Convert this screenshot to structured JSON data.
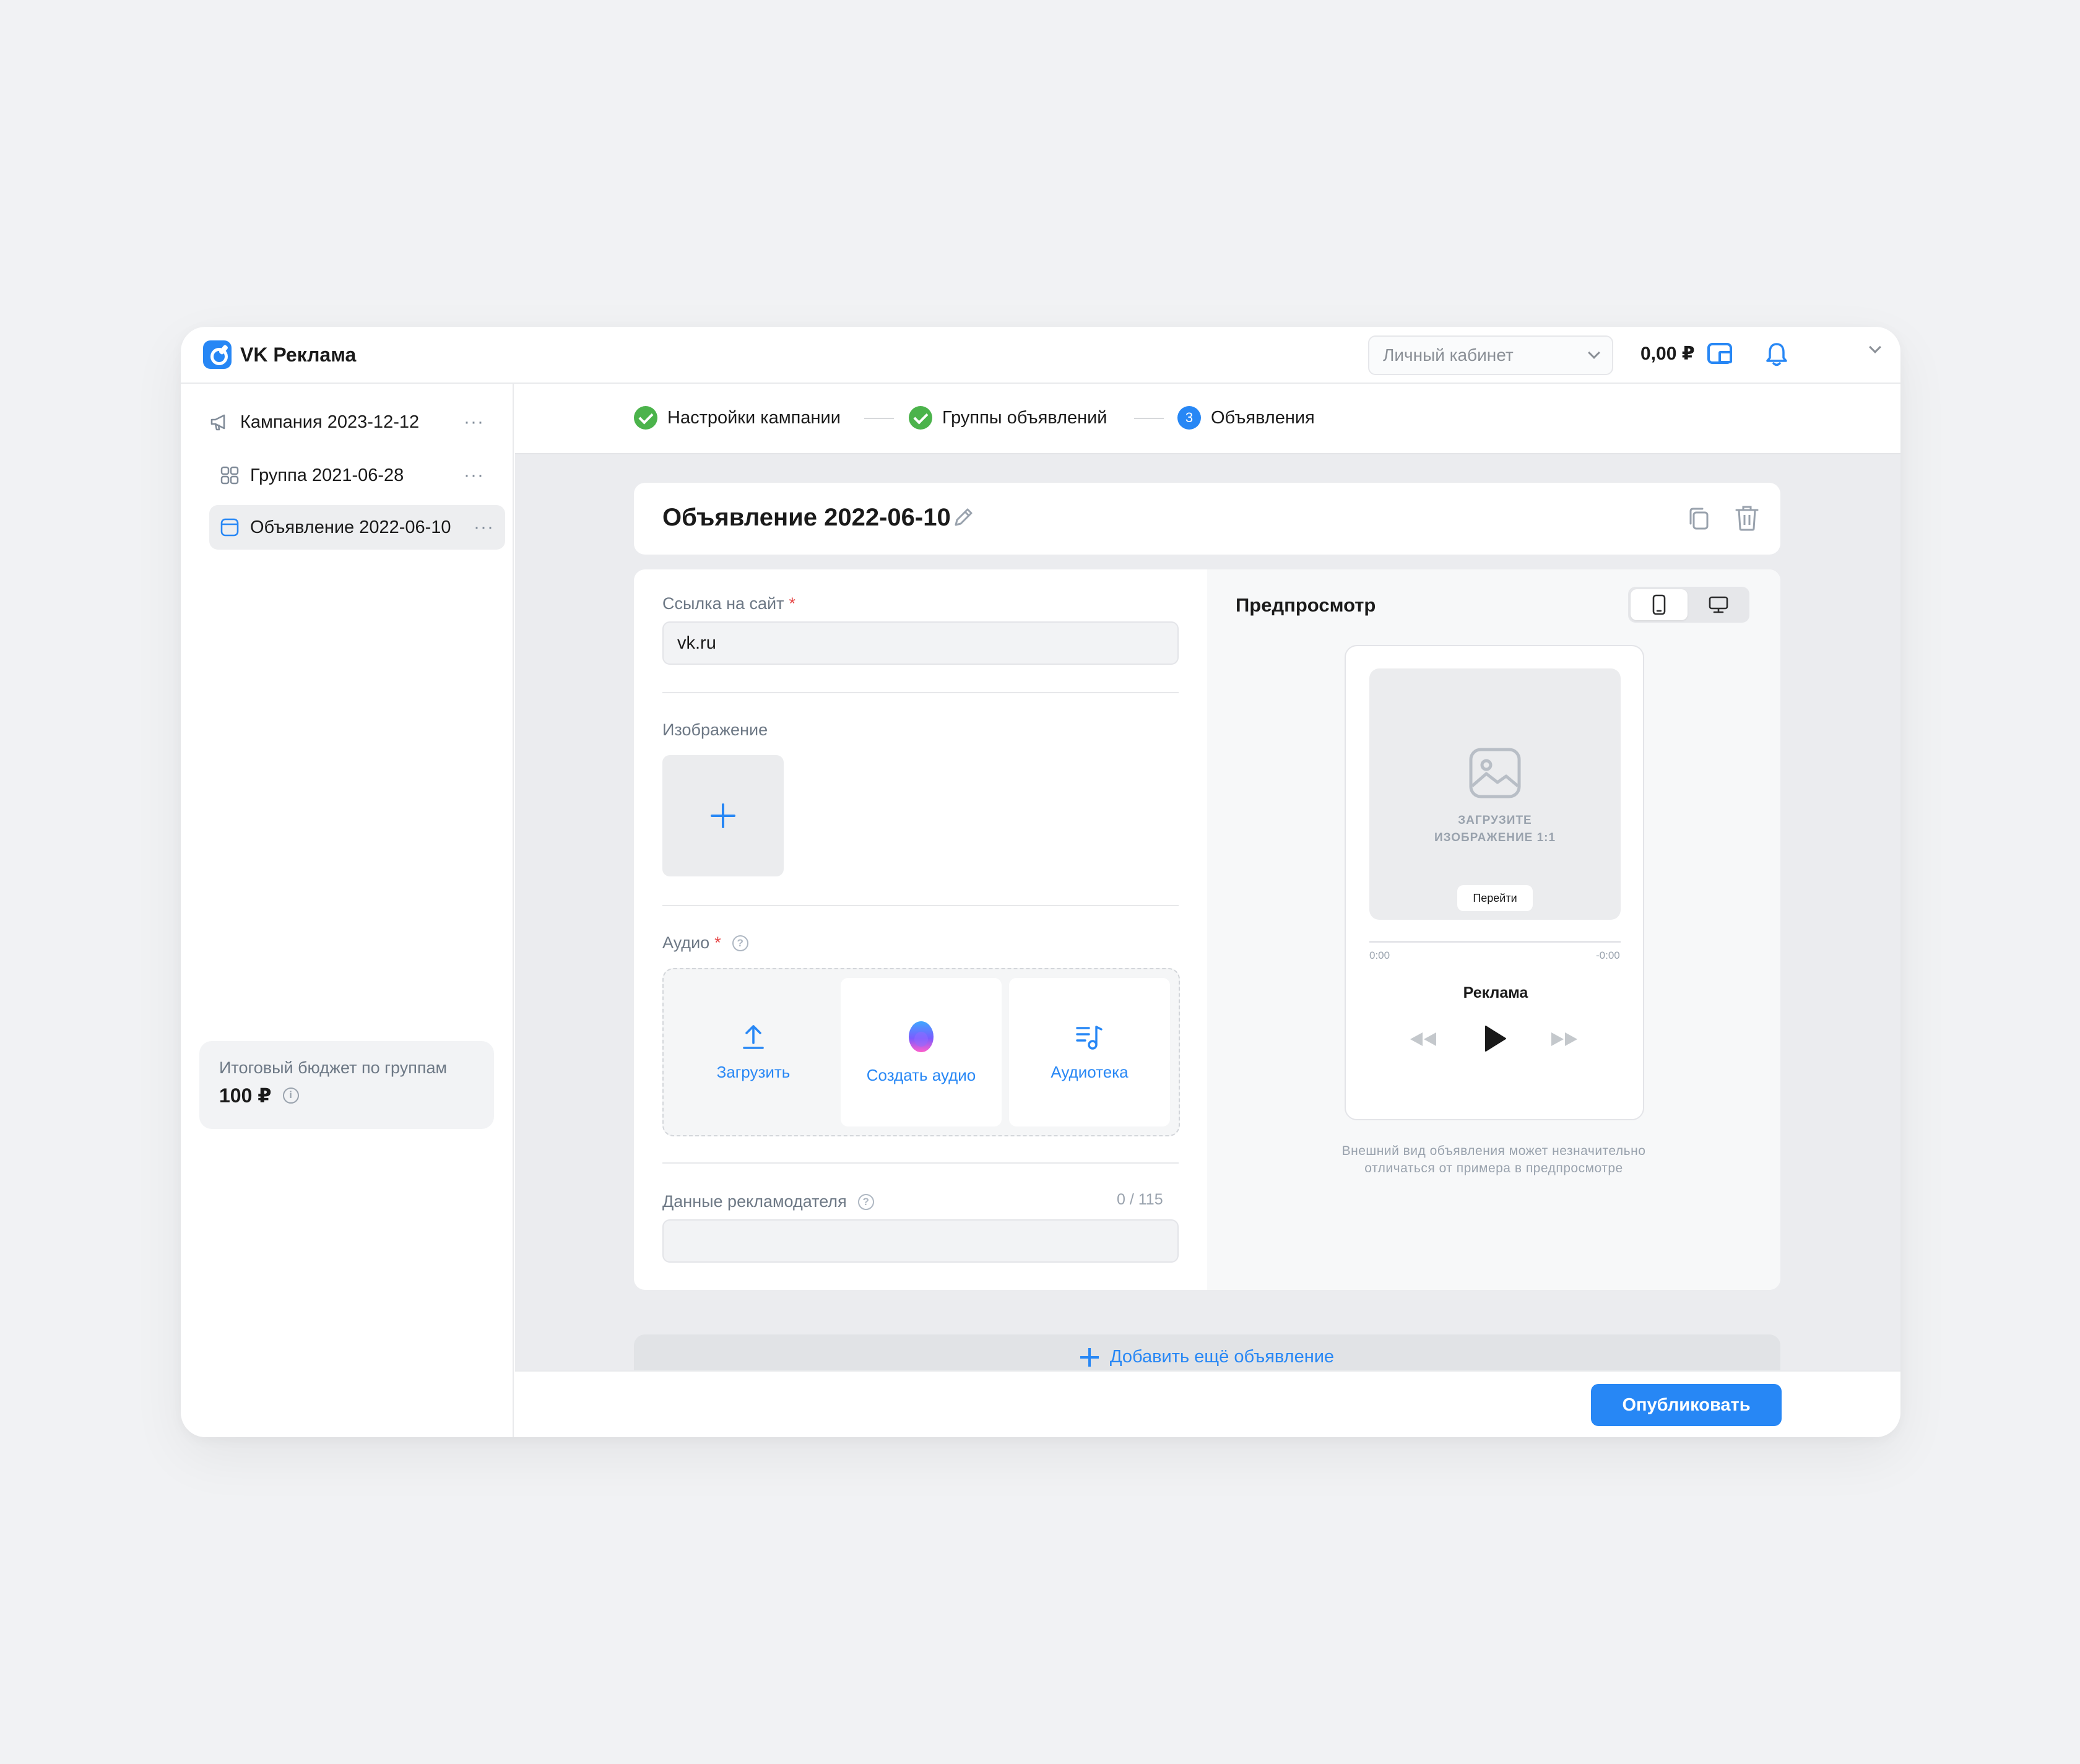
{
  "app": {
    "title": "VK Реклама",
    "brand_color": "#2787f5"
  },
  "header": {
    "account_select": "Личный кабинет",
    "balance": "0,00 ₽"
  },
  "sidebar": {
    "items": [
      {
        "label": "Кампания 2023-12-12",
        "icon": "megaphone-icon"
      },
      {
        "label": "Группа 2021-06-28",
        "icon": "grid-icon"
      },
      {
        "label": "Объявление 2022-06-10",
        "icon": "ad-card-icon",
        "active": true
      }
    ],
    "budget": {
      "title": "Итоговый бюджет по группам",
      "value": "100 ₽"
    }
  },
  "steps": [
    {
      "label": "Настройки кампании",
      "state": "done"
    },
    {
      "label": "Группы объявлений",
      "state": "done"
    },
    {
      "label": "Объявления",
      "state": "current",
      "number": "3"
    }
  ],
  "ad": {
    "title": "Объявление 2022-06-10"
  },
  "form": {
    "site_link": {
      "label": "Ссылка на сайт",
      "required": "*",
      "value": "vk.ru"
    },
    "image": {
      "label": "Изображение"
    },
    "audio": {
      "label": "Аудио",
      "required": "*",
      "options": [
        "Загрузить",
        "Создать аудио",
        "Аудиотека"
      ]
    },
    "advertiser": {
      "label": "Данные рекламодателя",
      "counter": "0 / 115",
      "value": ""
    }
  },
  "preview": {
    "title": "Предпросмотр",
    "placeholder_line1": "ЗАГРУЗИТЕ",
    "placeholder_line2": "ИЗОБРАЖЕНИЕ 1:1",
    "button": "Перейти",
    "time_start": "0:00",
    "time_end": "-0:00",
    "track": "Реклама",
    "note_line1": "Внешний вид объявления может незначительно",
    "note_line2": "отличаться от примера в предпросмотре"
  },
  "actions": {
    "add_ad": "Добавить ещё объявление",
    "publish": "Опубликовать"
  }
}
